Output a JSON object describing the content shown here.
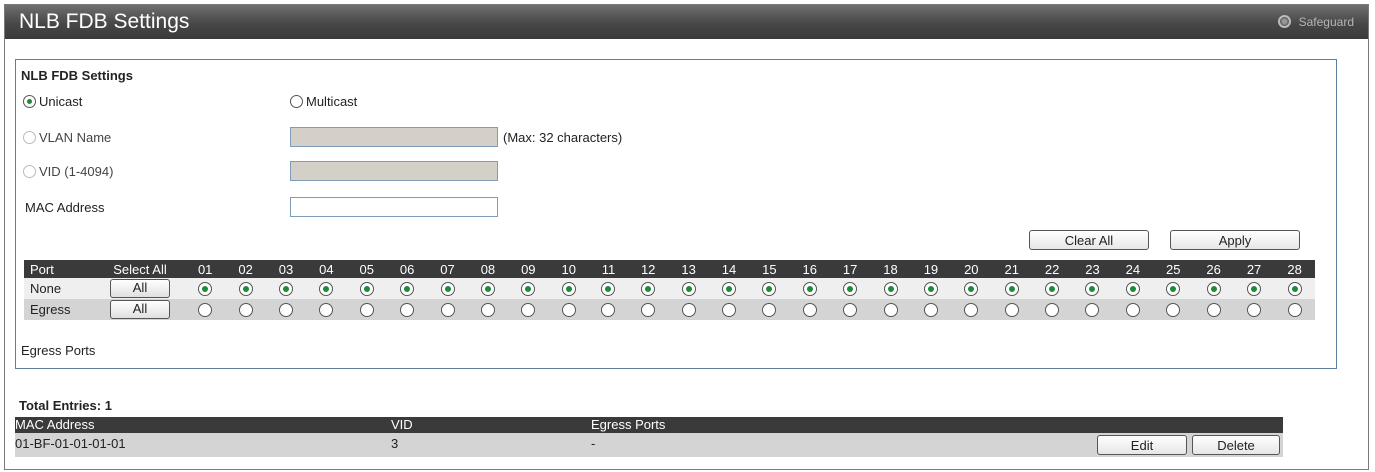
{
  "header": {
    "title": "NLB FDB Settings",
    "safeguard": "Safeguard"
  },
  "form": {
    "section_title": "NLB FDB Settings",
    "unicast_label": "Unicast",
    "multicast_label": "Multicast",
    "vlan_name_label": "VLAN Name",
    "vlan_name_hint": "(Max: 32 characters)",
    "vid_label": "VID (1-4094)",
    "mac_label": "MAC Address",
    "clear_all_label": "Clear All",
    "apply_label": "Apply"
  },
  "ports_table": {
    "port_header": "Port",
    "select_all_header": "Select All",
    "ports": [
      "01",
      "02",
      "03",
      "04",
      "05",
      "06",
      "07",
      "08",
      "09",
      "10",
      "11",
      "12",
      "13",
      "14",
      "15",
      "16",
      "17",
      "18",
      "19",
      "20",
      "21",
      "22",
      "23",
      "24",
      "25",
      "26",
      "27",
      "28"
    ],
    "rows": [
      {
        "label": "None",
        "button": "All",
        "selected": true
      },
      {
        "label": "Egress",
        "button": "All",
        "selected": false
      }
    ],
    "egress_ports_label": "Egress Ports"
  },
  "entries": {
    "total_label": "Total Entries: 1",
    "columns": [
      "MAC Address",
      "VID",
      "Egress Ports"
    ],
    "rows": [
      {
        "mac": "01-BF-01-01-01-01",
        "vid": "3",
        "egress": "-",
        "edit": "Edit",
        "delete": "Delete"
      }
    ]
  }
}
